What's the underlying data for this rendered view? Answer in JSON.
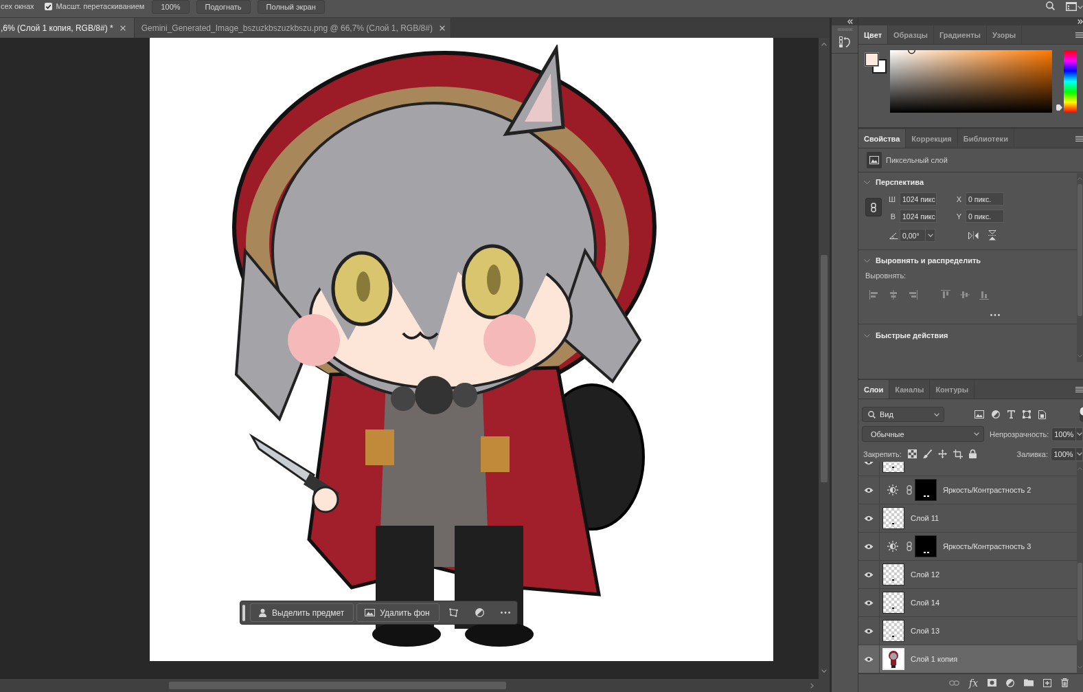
{
  "options_bar": {
    "items": [
      {
        "kind": "text",
        "label": "сех окнах"
      },
      {
        "kind": "checkbox",
        "label": "Масшт. перетаскиванием",
        "checked": true
      },
      {
        "kind": "button",
        "label": "100%"
      },
      {
        "kind": "button",
        "label": "Подогнать"
      },
      {
        "kind": "button",
        "label": "Полный экран"
      }
    ]
  },
  "document_tabs": [
    {
      "title": ",6% (Слой 1 копия, RGB/8#) *",
      "selected": true
    },
    {
      "title": "Gemini_Generated_Image_bszuzkbszuzkbszu.png @ 66,7% (Слой 1, RGB/8#)",
      "selected": false
    }
  ],
  "task_bar": {
    "buttons": [
      {
        "kind": "subject",
        "label": "Выделить предмет"
      },
      {
        "kind": "background",
        "label": "Удалить фон"
      }
    ]
  },
  "color_panel": {
    "tabs": [
      {
        "label": "Цвет",
        "selected": true
      },
      {
        "label": "Образцы",
        "selected": false
      },
      {
        "label": "Градиенты",
        "selected": false
      },
      {
        "label": "Узоры",
        "selected": false
      }
    ],
    "swatches": [
      {
        "kind": "foreground",
        "color": "#fdeadd"
      },
      {
        "kind": "background",
        "color": "#ffffff"
      }
    ],
    "hue_slider": {
      "level": 0.08
    }
  },
  "properties_panel": {
    "tabs": [
      {
        "label": "Свойства",
        "selected": true
      },
      {
        "label": "Коррекция",
        "selected": false
      },
      {
        "label": "Библиотеки",
        "selected": false
      }
    ],
    "layer_type": "Пиксельный слой",
    "sections": [
      {
        "kind": "transform",
        "title": "Перспектива",
        "expanded": true,
        "linked": true,
        "fields": [
          {
            "label": "Ш",
            "value": "1024 пикс"
          },
          {
            "label": "X",
            "value": "0 пикс."
          },
          {
            "label": "В",
            "value": "1024 пикс"
          },
          {
            "label": "Y",
            "value": "0 пикс."
          }
        ],
        "angle": "0,00°"
      },
      {
        "kind": "align",
        "title": "Выровнять и распределить",
        "expanded": true,
        "label": "Выровнять:"
      },
      {
        "kind": "quick_actions",
        "title": "Быстрые действия",
        "expanded": true
      }
    ]
  },
  "layers_panel": {
    "tabs": [
      {
        "label": "Слои",
        "selected": true
      },
      {
        "label": "Каналы",
        "selected": false
      },
      {
        "label": "Контуры",
        "selected": false
      }
    ],
    "filter": {
      "value": "Вид",
      "enabled": true
    },
    "blend_mode": {
      "value": "Обычные"
    },
    "opacity": {
      "label": "Непрозрачность:",
      "value": "100%"
    },
    "lock": {
      "label": "Закрепить:"
    },
    "fill": {
      "label": "Заливка:",
      "value": "100%"
    },
    "layers": [
      {
        "kind": "pixel",
        "visible": true,
        "selected": false
      },
      {
        "kind": "adjustment",
        "name": "Яркость/Контрастность 2",
        "visible": true,
        "selected": false
      },
      {
        "kind": "pixel",
        "name": "Слой 11",
        "visible": true,
        "selected": false
      },
      {
        "kind": "adjustment",
        "name": "Яркость/Контрастность 3",
        "visible": true,
        "selected": false
      },
      {
        "kind": "pixel",
        "name": "Слой 12",
        "visible": true,
        "selected": false
      },
      {
        "kind": "pixel",
        "name": "Слой 14",
        "visible": true,
        "selected": false
      },
      {
        "kind": "pixel",
        "name": "Слой 13",
        "visible": true,
        "selected": false
      },
      {
        "kind": "artwork",
        "name": "Слой 1 копия",
        "visible": true,
        "selected": true
      }
    ],
    "effects_label": "fx"
  }
}
